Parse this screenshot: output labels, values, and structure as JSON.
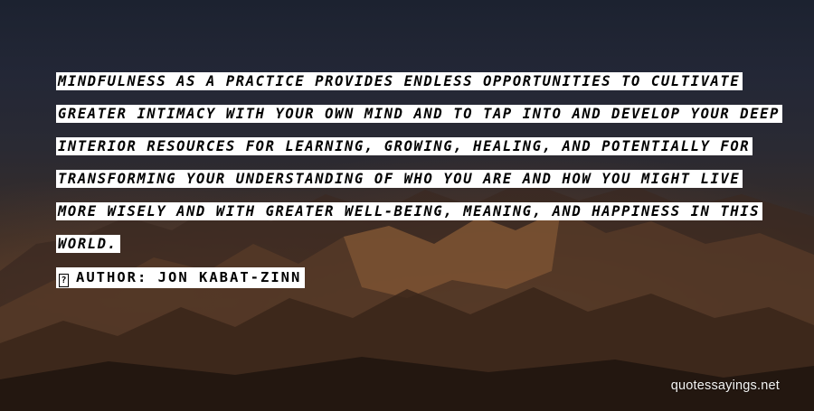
{
  "quote": {
    "lines": [
      "MINDFULNESS AS A PRACTICE PROVIDES ENDLESS OPPORTUNITIES TO CULTIVATE",
      "GREATER INTIMACY WITH YOUR OWN MIND AND TO TAP INTO AND DEVELOP YOUR DEEP",
      "INTERIOR RESOURCES FOR LEARNING, GROWING, HEALING, AND POTENTIALLY FOR",
      "TRANSFORMING YOUR UNDERSTANDING OF WHO YOU ARE AND HOW YOU MIGHT LIVE",
      "MORE WISELY AND WITH GREATER WELL-BEING, MEANING, AND HAPPINESS IN THIS",
      "WORLD."
    ],
    "author_glyph": "?",
    "author_prefix": "AUTHOR:",
    "author_name": "JON KABAT-ZINN"
  },
  "watermark": {
    "text": "quotessayings.net"
  },
  "colors": {
    "text_box_bg": "#ffffff",
    "text_color": "#000000",
    "watermark_color": "#ffffff"
  }
}
